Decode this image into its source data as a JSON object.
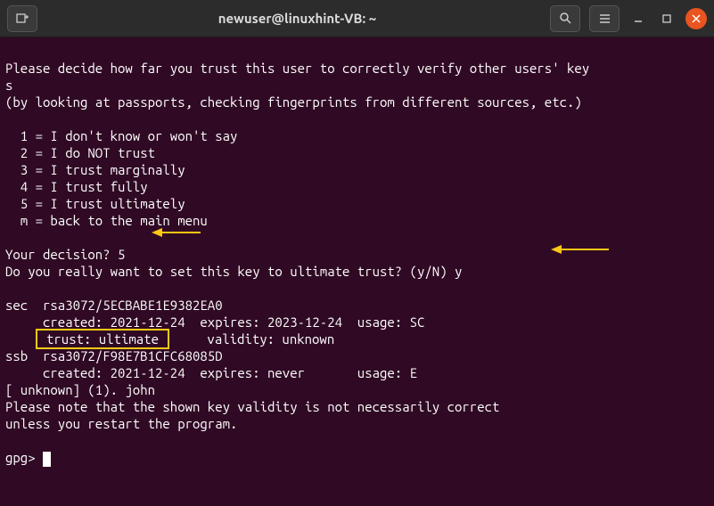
{
  "titlebar": {
    "title": "newuser@linuxhint-VB: ~"
  },
  "terminal": {
    "line1": "Please decide how far you trust this user to correctly verify other users' key",
    "line2": "s",
    "line3": "(by looking at passports, checking fingerprints from different sources, etc.)",
    "opt1": "  1 = I don't know or won't say",
    "opt2": "  2 = I do NOT trust",
    "opt3": "  3 = I trust marginally",
    "opt4": "  4 = I trust fully",
    "opt5": "  5 = I trust ultimately",
    "optm": "  m = back to the main menu",
    "decision": "Your decision? 5",
    "confirm": "Do you really want to set this key to ultimate trust? (y/N) y",
    "sec": "sec  rsa3072/5ECBABE1E9382EA0",
    "sec_created": "     created: 2021-12-24  expires: 2023-12-24  usage: SC  ",
    "trust_pre": "    ",
    "trust_box": " trust: ultimate ",
    "trust_post": "     validity: unknown",
    "ssb": "ssb  rsa3072/F98E7B1CFC68085D",
    "ssb_created": "     created: 2021-12-24  expires: never       usage: E   ",
    "unknown": "[ unknown] (1). john",
    "note1": "Please note that the shown key validity is not necessarily correct",
    "note2": "unless you restart the program.",
    "prompt": "gpg> "
  }
}
